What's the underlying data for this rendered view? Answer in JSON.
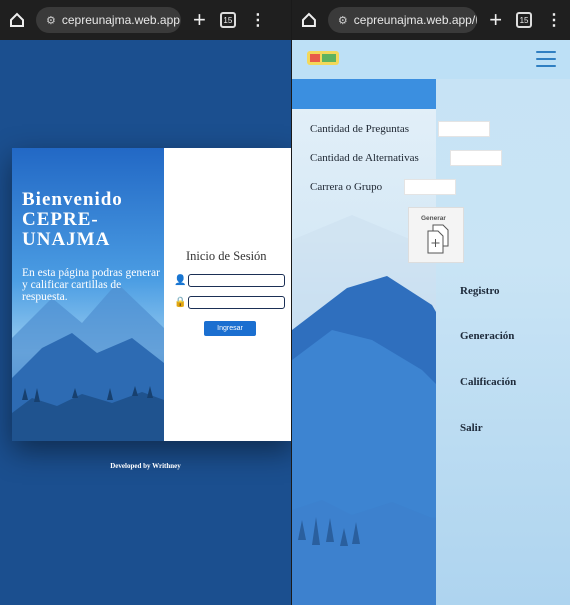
{
  "browser_left": {
    "url": "cepreunajma.web.app",
    "tab_count": "15"
  },
  "browser_right": {
    "url": "cepreunajma.web.app/Pr",
    "tab_count": "15"
  },
  "login_screen": {
    "hero": {
      "welcome_line1": "Bienvenido",
      "welcome_line2": "CEPRE-",
      "welcome_line3": "UNAJMA",
      "description": "En esta página podras generar y calificar cartillas de respuesta."
    },
    "form": {
      "title": "Inicio de Sesión",
      "user_value": "",
      "password_value": "",
      "submit_label": "Ingresar"
    },
    "footer": "Developed by Writhney"
  },
  "generator_screen": {
    "form": {
      "questions_label": "Cantidad de Preguntas",
      "alternatives_label": "Cantidad de Alternativas",
      "career_label": "Carrera o Grupo",
      "questions_value": "",
      "alternatives_value": "",
      "career_value": "",
      "generate_label": "Generar"
    },
    "menu": [
      {
        "label": "Registro"
      },
      {
        "label": "Generación"
      },
      {
        "label": "Calificación"
      },
      {
        "label": "Salir"
      }
    ]
  },
  "colors": {
    "page_bg": "#1b4f8f",
    "accent_button": "#1b6fd0",
    "sidebar_bg": "#c7e3f5",
    "nav_bg": "#bde0f6",
    "hamburger": "#2f7fc2"
  }
}
